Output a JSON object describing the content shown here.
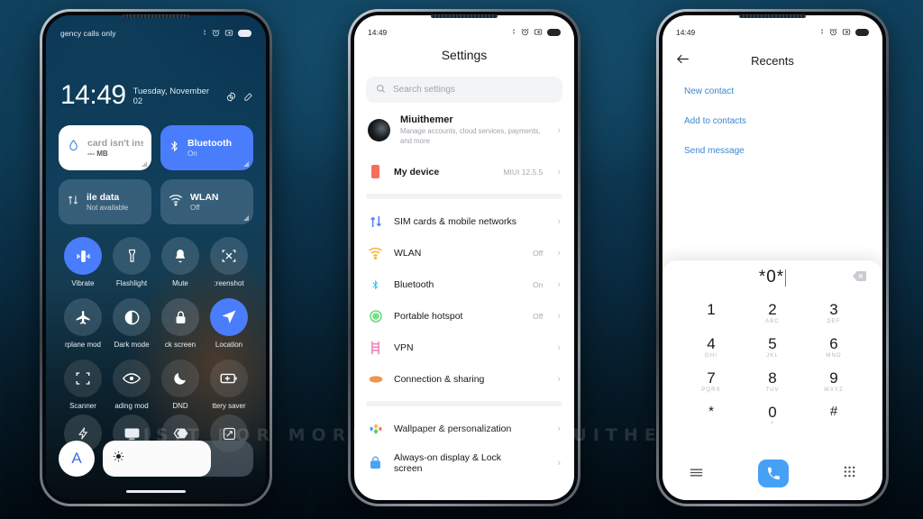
{
  "watermark": "VISIT  FOR  MORE  THEMES  -  MIUITHEMER.COM",
  "phone1": {
    "name": "control-center",
    "status": {
      "carrier": "gency calls only",
      "icons": [
        "bluetooth-icon",
        "alarm-icon",
        "screenshot-icon",
        "battery-icon"
      ]
    },
    "clock": {
      "time": "14:49",
      "date": "Tuesday, November 02"
    },
    "big_tiles_row1": [
      {
        "title": "card isn't insta",
        "sub": "--- MB",
        "icon": "data-drop-icon",
        "style": "white"
      },
      {
        "title": "Bluetooth",
        "sub": "On",
        "icon": "bluetooth-icon",
        "style": "blue"
      }
    ],
    "big_tiles_row2": [
      {
        "title": "ile data",
        "sub": "Not available",
        "icon": "mobile-data-icon",
        "style": "glass"
      },
      {
        "title": "WLAN",
        "sub": "Off",
        "icon": "wifi-icon",
        "style": "glass"
      }
    ],
    "toggles": [
      {
        "label": "Vibrate",
        "icon": "vibrate-icon",
        "state": "on"
      },
      {
        "label": "Flashlight",
        "icon": "flashlight-icon",
        "state": "off"
      },
      {
        "label": "Mute",
        "icon": "bell-icon",
        "state": "off"
      },
      {
        "label": ":reenshot",
        "icon": "screenshot-icon",
        "state": "off"
      },
      {
        "label": "rplane mod",
        "icon": "airplane-icon",
        "state": "off"
      },
      {
        "label": "Dark mode",
        "icon": "dark-mode-icon",
        "state": "off"
      },
      {
        "label": "ck screen",
        "icon": "lock-icon",
        "state": "off"
      },
      {
        "label": "Location",
        "icon": "location-icon",
        "state": "on"
      },
      {
        "label": "Scanner",
        "icon": "scanner-icon",
        "state": "off"
      },
      {
        "label": "ading mod",
        "icon": "reading-mode-icon",
        "state": "off"
      },
      {
        "label": "DND",
        "icon": "moon-icon",
        "state": "off"
      },
      {
        "label": "ttery saver",
        "icon": "battery-saver-icon",
        "state": "off"
      }
    ],
    "toggles_row4": [
      {
        "label": "",
        "icon": "flash-icon"
      },
      {
        "label": "",
        "icon": "cast-icon"
      },
      {
        "label": "",
        "icon": "contrast-icon"
      },
      {
        "label": "",
        "icon": "rotate-icon"
      }
    ],
    "brightness": {
      "auto_label": "A",
      "icon": "sun-icon",
      "level": 72
    }
  },
  "phone2": {
    "name": "settings",
    "status": {
      "time": "14:49",
      "icons": [
        "bluetooth-icon",
        "alarm-icon",
        "screenshot-icon",
        "battery-icon"
      ]
    },
    "title": "Settings",
    "search": {
      "placeholder": "Search settings",
      "icon": "search-icon"
    },
    "account": {
      "name": "Miuithemer",
      "subtitle": "Manage accounts, cloud services, payments, and more"
    },
    "device": {
      "label": "My device",
      "value": "MIUI 12.5.5"
    },
    "group1": [
      {
        "label": "SIM cards & mobile networks",
        "value": "",
        "icon": "sim-icon",
        "color": "#4f86f7"
      },
      {
        "label": "WLAN",
        "value": "Off",
        "icon": "wifi-icon",
        "color": "#f5b942"
      },
      {
        "label": "Bluetooth",
        "value": "On",
        "icon": "bluetooth-icon",
        "color": "#30c2f0"
      },
      {
        "label": "Portable hotspot",
        "value": "Off",
        "icon": "hotspot-icon",
        "color": "#4ed46a"
      },
      {
        "label": "VPN",
        "value": "",
        "icon": "vpn-icon",
        "color": "#f07ab0"
      },
      {
        "label": "Connection & sharing",
        "value": "",
        "icon": "connection-icon",
        "color": "#f0954d"
      }
    ],
    "group2": [
      {
        "label": "Wallpaper & personalization",
        "value": "",
        "icon": "wallpaper-icon",
        "color": "#f0c14d"
      },
      {
        "label": "Always-on display & Lock screen",
        "value": "",
        "icon": "lockscreen-icon",
        "color": "#4aa3f0"
      }
    ]
  },
  "phone3": {
    "name": "recents-dialer",
    "status": {
      "time": "14:49",
      "icons": [
        "bluetooth-icon",
        "alarm-icon",
        "screenshot-icon",
        "battery-icon"
      ]
    },
    "title": "Recents",
    "back_icon": "back-arrow-icon",
    "actions": [
      "New contact",
      "Add to contacts",
      "Send message"
    ],
    "dial": {
      "number": "*0*",
      "backspace_icon": "backspace-icon",
      "keys": [
        {
          "digit": "1",
          "sub": ""
        },
        {
          "digit": "2",
          "sub": "ABC"
        },
        {
          "digit": "3",
          "sub": "DEF"
        },
        {
          "digit": "4",
          "sub": "GHI"
        },
        {
          "digit": "5",
          "sub": "JKL"
        },
        {
          "digit": "6",
          "sub": "MNO"
        },
        {
          "digit": "7",
          "sub": "PQRS"
        },
        {
          "digit": "8",
          "sub": "TUV"
        },
        {
          "digit": "9",
          "sub": "WXYZ"
        },
        {
          "digit": "*",
          "sub": ""
        },
        {
          "digit": "0",
          "sub": "+"
        },
        {
          "digit": "#",
          "sub": ""
        }
      ],
      "footer": {
        "left_icon": "menu-icon",
        "call_icon": "call-icon",
        "right_icon": "keypad-icon"
      }
    }
  },
  "colors": {
    "accent_blue": "#4a7dfb",
    "link_blue": "#3d86d4",
    "call_blue": "#46a0f5",
    "background": "#0c3a57"
  }
}
